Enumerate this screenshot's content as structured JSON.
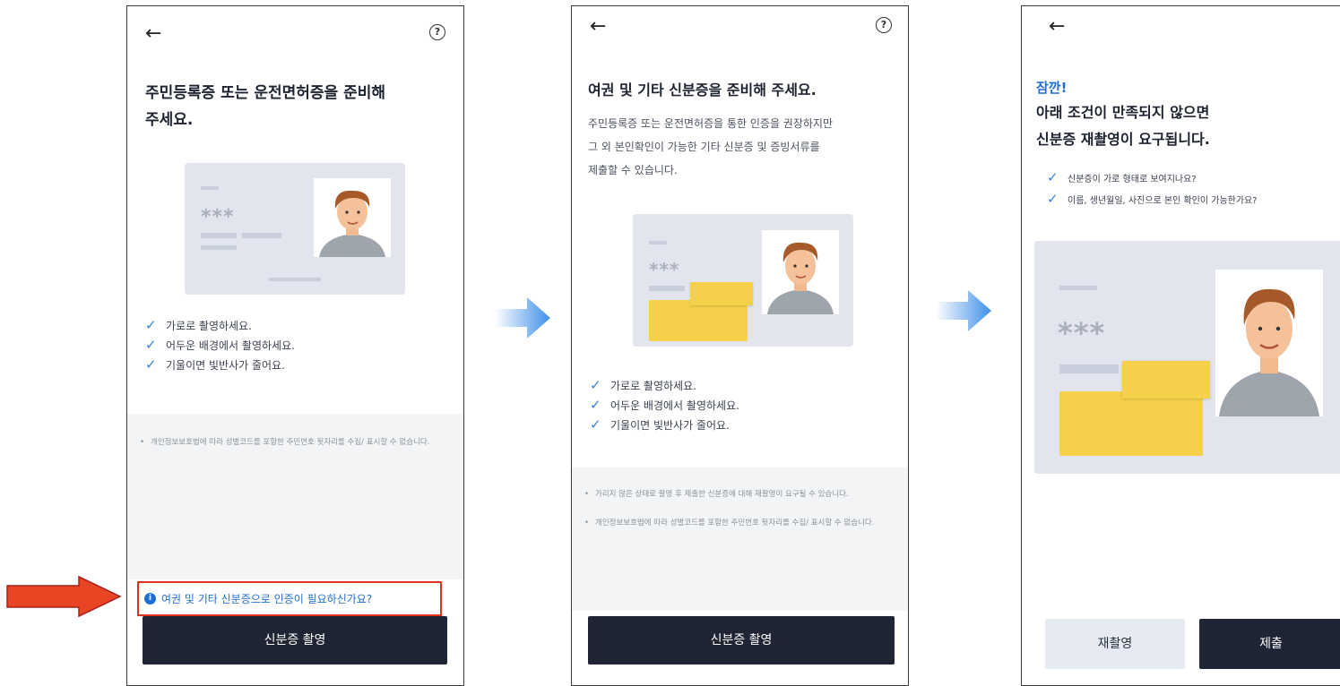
{
  "screen1": {
    "back_icon": "arrow-left",
    "help_icon": "question-circle",
    "title_line1": "주민등록증 또는 운전면허증을 준비해",
    "title_line2": "주세요.",
    "checks": [
      "가로로 촬영하세요.",
      "어두운 배경에서 촬영하세요.",
      "기울이면 빛반사가 줄어요."
    ],
    "card_mask": "***",
    "notes": [
      "개인정보보호법에 따라 성별코드를 포함한 주민번호 뒷자리를 수집/ 표시할 수 없습니다."
    ],
    "info_link": "여권 및 기타 신분증으로 인증이 필요하신가요?",
    "button": "신분증 촬영"
  },
  "screen2": {
    "back_icon": "arrow-left",
    "help_icon": "question-circle",
    "title": "여권 및 기타 신분증을 준비해 주세요.",
    "desc_lines": [
      "주민등록증 또는 운전면허증을 통한 인증을 권장하지만",
      "그 외 본인확인이 가능한 기타 신분증 및 증빙서류를",
      "제출할 수 있습니다."
    ],
    "checks": [
      "가로로 촬영하세요.",
      "어두운 배경에서 촬영하세요.",
      "기울이면 빛반사가 줄어요."
    ],
    "card_mask": "***",
    "notes": [
      "가리지 않은 상태로 촬영 후 제출한 신분증에 대해 재촬영이 요구될 수 있습니다.",
      "개인정보보호법에 따라 성별코드를 포함한 주민번호 뒷자리를 수집/ 표시할 수 없습니다."
    ],
    "button": "신분증 촬영"
  },
  "screen3": {
    "back_icon": "arrow-left",
    "heading_accent": "잠깐!",
    "heading_line1": "아래 조건이 만족되지 않으면",
    "heading_line2": "신분증 재촬영이 요구됩니다.",
    "checks": [
      "신분증이 가로 형태로 보여지나요?",
      "이름, 생년월일, 사진으로 본인 확인이 가능한가요?"
    ],
    "card_mask": "***",
    "retake_button": "재촬영",
    "submit_button": "제출"
  },
  "colors": {
    "accent_blue": "#1d6fd1",
    "check_blue": "#3b82d8",
    "dark_button": "#1f2535",
    "highlight_red": "#e0321f",
    "sticky_yellow": "#f5d04a"
  },
  "annotations": {
    "left_arrow": "red-arrow-right-icon",
    "flow_arrows": "blue-arrow-right-icon"
  }
}
